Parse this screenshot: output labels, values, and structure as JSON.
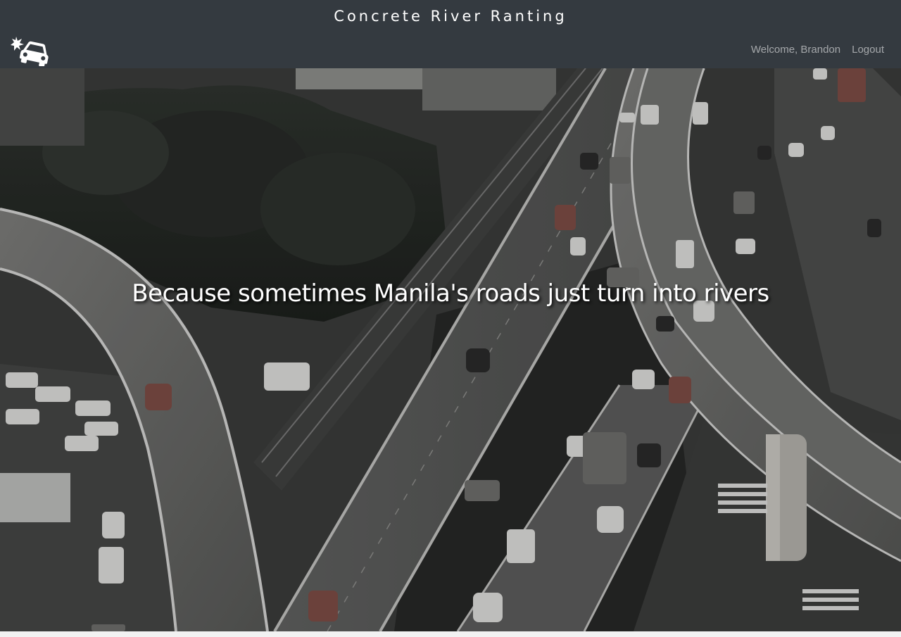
{
  "header": {
    "site_title": "Concrete River Ranting",
    "logo_icon": "car-crash-icon",
    "welcome_text": "Welcome, Brandon",
    "logout_label": "Logout"
  },
  "hero": {
    "tagline": "Because sometimes Manila's roads just turn into rivers",
    "image_subject": "aerial view of elevated highway interchanges with traffic"
  },
  "colors": {
    "navbar_bg": "#343a40",
    "navbar_text": "#ffffff",
    "nav_link": "rgba(255,255,255,0.55)"
  }
}
